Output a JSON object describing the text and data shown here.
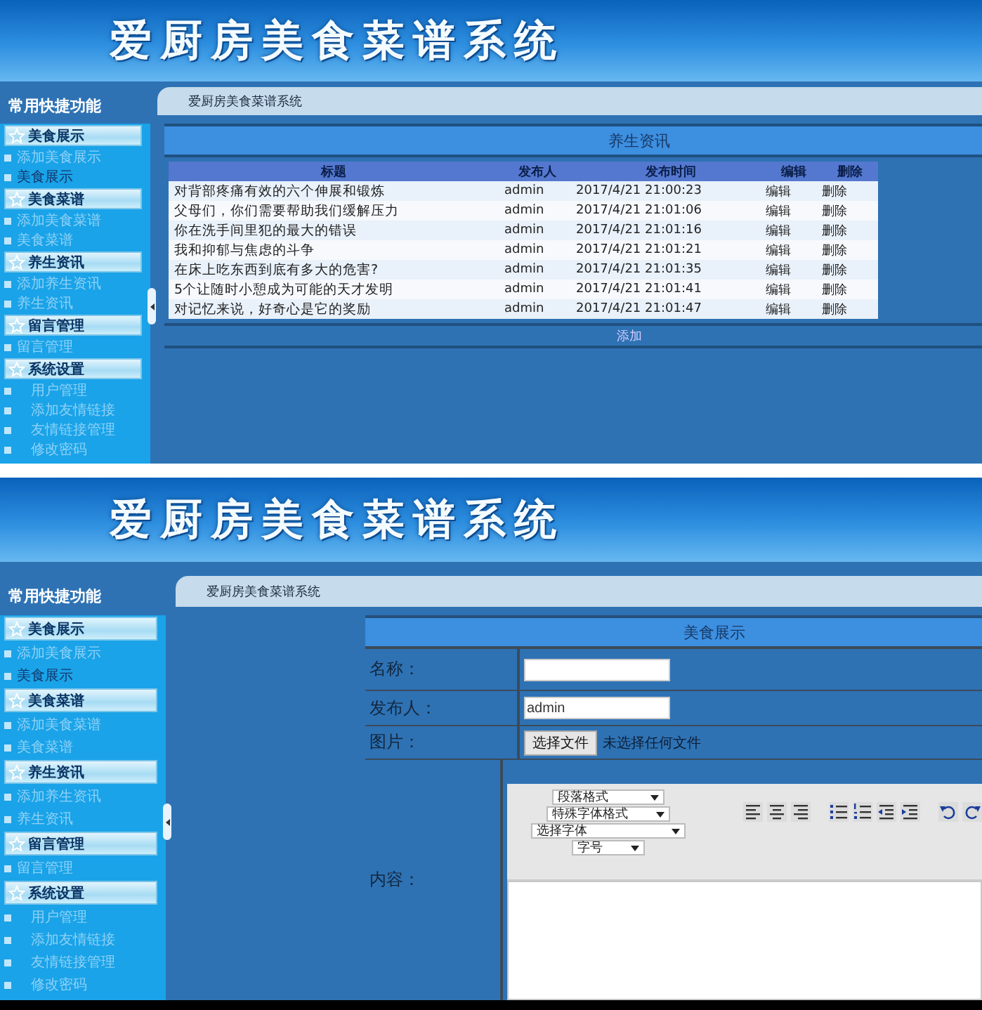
{
  "screens": [
    {
      "kind": "list",
      "header": {
        "title": "爱厨房美食菜谱系统"
      },
      "sidebar": {
        "title": "常用快捷功能",
        "groups": [
          {
            "label": "美食展示",
            "indent": false,
            "items": [
              {
                "label": "添加美食展示",
                "selected": false
              },
              {
                "label": "美食展示",
                "selected": true
              }
            ]
          },
          {
            "label": "美食菜谱",
            "indent": false,
            "items": [
              {
                "label": "添加美食菜谱",
                "selected": false
              },
              {
                "label": "美食菜谱",
                "selected": false
              }
            ]
          },
          {
            "label": "养生资讯",
            "indent": false,
            "items": [
              {
                "label": "添加养生资讯",
                "selected": false
              },
              {
                "label": "养生资讯",
                "selected": false
              }
            ]
          },
          {
            "label": "留言管理",
            "indent": false,
            "items": [
              {
                "label": "留言管理",
                "selected": false
              }
            ]
          },
          {
            "label": "系统设置",
            "indent": true,
            "items": [
              {
                "label": "用户管理",
                "selected": false
              },
              {
                "label": "添加友情链接",
                "selected": false
              },
              {
                "label": "友情链接管理",
                "selected": false
              },
              {
                "label": "修改密码",
                "selected": false
              }
            ]
          }
        ]
      },
      "breadcrumb": "爱厨房美食菜谱系统",
      "panel": {
        "title": "养生资讯",
        "table": {
          "columns": [
            "标题",
            "发布人",
            "发布时间",
            "编辑",
            "删除"
          ],
          "rows": [
            [
              "对背部疼痛有效的六个伸展和锻炼",
              "admin",
              "2017/4/21 21:00:23",
              "编辑",
              "删除"
            ],
            [
              "父母们，你们需要帮助我们缓解压力",
              "admin",
              "2017/4/21 21:01:06",
              "编辑",
              "删除"
            ],
            [
              "你在洗手间里犯的最大的错误",
              "admin",
              "2017/4/21 21:01:16",
              "编辑",
              "删除"
            ],
            [
              "我和抑郁与焦虑的斗争",
              "admin",
              "2017/4/21 21:01:21",
              "编辑",
              "删除"
            ],
            [
              "在床上吃东西到底有多大的危害?",
              "admin",
              "2017/4/21 21:01:35",
              "编辑",
              "删除"
            ],
            [
              "5个让随时小憩成为可能的天才发明",
              "admin",
              "2017/4/21 21:01:41",
              "编辑",
              "删除"
            ],
            [
              "对记忆来说，好奇心是它的奖励",
              "admin",
              "2017/4/21 21:01:47",
              "编辑",
              "删除"
            ]
          ]
        },
        "footer_link": "添加"
      }
    },
    {
      "kind": "form",
      "header": {
        "title": "爱厨房美食菜谱系统"
      },
      "sidebar": {
        "title": "常用快捷功能",
        "groups": [
          {
            "label": "美食展示",
            "indent": false,
            "items": [
              {
                "label": "添加美食展示",
                "selected": false
              },
              {
                "label": "美食展示",
                "selected": true
              }
            ]
          },
          {
            "label": "美食菜谱",
            "indent": false,
            "items": [
              {
                "label": "添加美食菜谱",
                "selected": false
              },
              {
                "label": "美食菜谱",
                "selected": false
              }
            ]
          },
          {
            "label": "养生资讯",
            "indent": false,
            "items": [
              {
                "label": "添加养生资讯",
                "selected": false
              },
              {
                "label": "养生资讯",
                "selected": false
              }
            ]
          },
          {
            "label": "留言管理",
            "indent": false,
            "items": [
              {
                "label": "留言管理",
                "selected": false
              }
            ]
          },
          {
            "label": "系统设置",
            "indent": true,
            "items": [
              {
                "label": "用户管理",
                "selected": false
              },
              {
                "label": "添加友情链接",
                "selected": false
              },
              {
                "label": "友情链接管理",
                "selected": false
              },
              {
                "label": "修改密码",
                "selected": false
              }
            ]
          }
        ]
      },
      "breadcrumb": "爱厨房美食菜谱系统",
      "panel": {
        "title": "美食展示",
        "fields": [
          {
            "kind": "text",
            "label": "名称："
          },
          {
            "kind": "text",
            "label": "发布人：",
            "value": "admin"
          },
          {
            "kind": "file",
            "label": "图片：",
            "button": "选择文件",
            "status": "未选择任何文件"
          },
          {
            "kind": "editor",
            "label": "内容：",
            "selects": [
              "段落格式",
              "特殊字体格式",
              "选择字体",
              "字号"
            ]
          }
        ]
      }
    }
  ]
}
